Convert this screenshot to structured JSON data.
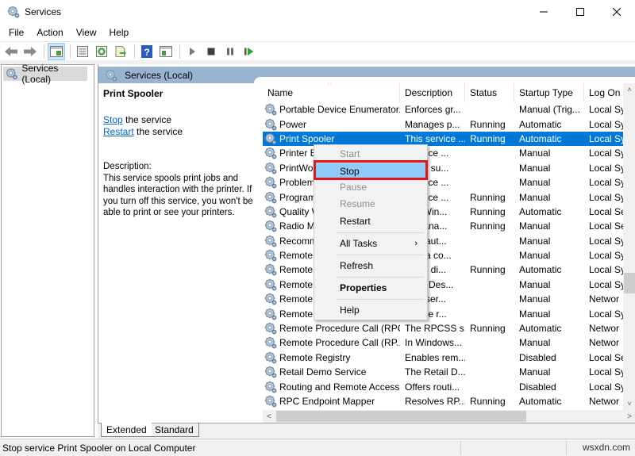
{
  "window": {
    "title": "Services",
    "app_icon": "gear-services-icon",
    "controls": [
      "minimize-icon",
      "maximize-icon",
      "close-icon"
    ]
  },
  "menu": [
    "File",
    "Action",
    "View",
    "Help"
  ],
  "toolbar": {
    "buttons": [
      "back-arrow-icon",
      "forward-arrow-icon",
      "show-hide-console-tree-icon",
      "properties-icon",
      "refresh-icon",
      "export-list-icon",
      "help-icon",
      "show-action-pane-icon",
      "start-service-icon",
      "stop-service-icon",
      "pause-service-icon",
      "restart-service-icon"
    ]
  },
  "tree": {
    "items": [
      {
        "label": "Services (Local)",
        "icon": "gear-services-icon"
      }
    ]
  },
  "main": {
    "header": "Services (Local)",
    "detail": {
      "title": "Print Spooler",
      "stop_link": "Stop",
      "stop_suffix": " the service",
      "restart_link": "Restart",
      "restart_suffix": " the service",
      "description_label": "Description:",
      "description": "This service spools print jobs and handles interaction with the printer. If you turn off this service, you won't be able to print or see your printers."
    },
    "columns": [
      "Name",
      "Description",
      "Status",
      "Startup Type",
      "Log On"
    ],
    "sorted_column": "Name",
    "rows": [
      {
        "name": "Portable Device Enumerator...",
        "desc": "Enforces gr...",
        "status": "",
        "startup": "Manual (Trig...",
        "logon": "Local Sy"
      },
      {
        "name": "Power",
        "desc": "Manages p...",
        "status": "Running",
        "startup": "Automatic",
        "logon": "Local Sy"
      },
      {
        "name": "Print Spooler",
        "desc": "This service ...",
        "status": "Running",
        "startup": "Automatic",
        "logon": "Local Sy",
        "selected": true
      },
      {
        "name": "Printer E",
        "desc": "...ervice ...",
        "status": "",
        "startup": "Manual",
        "logon": "Local Sy"
      },
      {
        "name": "PrintWo",
        "desc": "...des su...",
        "status": "",
        "startup": "Manual",
        "logon": "Local Sy"
      },
      {
        "name": "Problem",
        "desc": "...ervice ...",
        "status": "",
        "startup": "Manual",
        "logon": "Local Sy"
      },
      {
        "name": "Program",
        "desc": "...ervice ...",
        "status": "Running",
        "startup": "Manual",
        "logon": "Local Sy"
      },
      {
        "name": "Quality W",
        "desc": "...ty Win...",
        "status": "Running",
        "startup": "Automatic",
        "logon": "Local Se"
      },
      {
        "name": "Radio M",
        "desc": "... Mana...",
        "status": "Running",
        "startup": "Manual",
        "logon": "Local Se"
      },
      {
        "name": "Recomm",
        "desc": "...es aut...",
        "status": "",
        "startup": "Manual",
        "logon": "Local Sy"
      },
      {
        "name": "Remote",
        "desc": "...es a co...",
        "status": "",
        "startup": "Manual",
        "logon": "Local Sy"
      },
      {
        "name": "Remote",
        "desc": "...ges di...",
        "status": "Running",
        "startup": "Automatic",
        "logon": "Local Sy"
      },
      {
        "name": "Remote",
        "desc": "...ote Des...",
        "status": "",
        "startup": "Manual",
        "logon": "Local Sy"
      },
      {
        "name": "Remote",
        "desc": "...s user...",
        "status": "",
        "startup": "Manual",
        "logon": "Networ"
      },
      {
        "name": "Remote",
        "desc": "...s the r...",
        "status": "",
        "startup": "Manual",
        "logon": "Local Sy"
      },
      {
        "name": "Remote Procedure Call (RPC)",
        "desc": "The RPCSS s...",
        "status": "Running",
        "startup": "Automatic",
        "logon": "Networ"
      },
      {
        "name": "Remote Procedure Call (RP...",
        "desc": "In Windows...",
        "status": "",
        "startup": "Manual",
        "logon": "Networ"
      },
      {
        "name": "Remote Registry",
        "desc": "Enables rem...",
        "status": "",
        "startup": "Disabled",
        "logon": "Local Se"
      },
      {
        "name": "Retail Demo Service",
        "desc": "The Retail D...",
        "status": "",
        "startup": "Manual",
        "logon": "Local Sy"
      },
      {
        "name": "Routing and Remote Access",
        "desc": "Offers routi...",
        "status": "",
        "startup": "Disabled",
        "logon": "Local Sy"
      },
      {
        "name": "RPC Endpoint Mapper",
        "desc": "Resolves RP...",
        "status": "Running",
        "startup": "Automatic",
        "logon": "Networ"
      }
    ],
    "tabs": [
      "Extended",
      "Standard"
    ],
    "active_tab": "Extended"
  },
  "context_menu": {
    "items": [
      {
        "label": "Start",
        "disabled": true
      },
      {
        "label": "Stop",
        "highlighted": true
      },
      {
        "label": "Pause",
        "disabled": true
      },
      {
        "label": "Resume",
        "disabled": true
      },
      {
        "label": "Restart"
      },
      {
        "label": "All Tasks",
        "submenu": true
      },
      {
        "label": "Refresh"
      },
      {
        "label": "Properties",
        "bold": true
      },
      {
        "label": "Help"
      }
    ],
    "submenu_arrow": "›",
    "highlight_color": "#e0131e"
  },
  "statusbar": {
    "text": "Stop service Print Spooler on Local Computer",
    "watermark": "wsxdn.com"
  },
  "colors": {
    "selection": "#0078d7",
    "header_bar": "#99b4d1",
    "menu_highlight": "#91c9f7",
    "link": "#0066cc"
  }
}
